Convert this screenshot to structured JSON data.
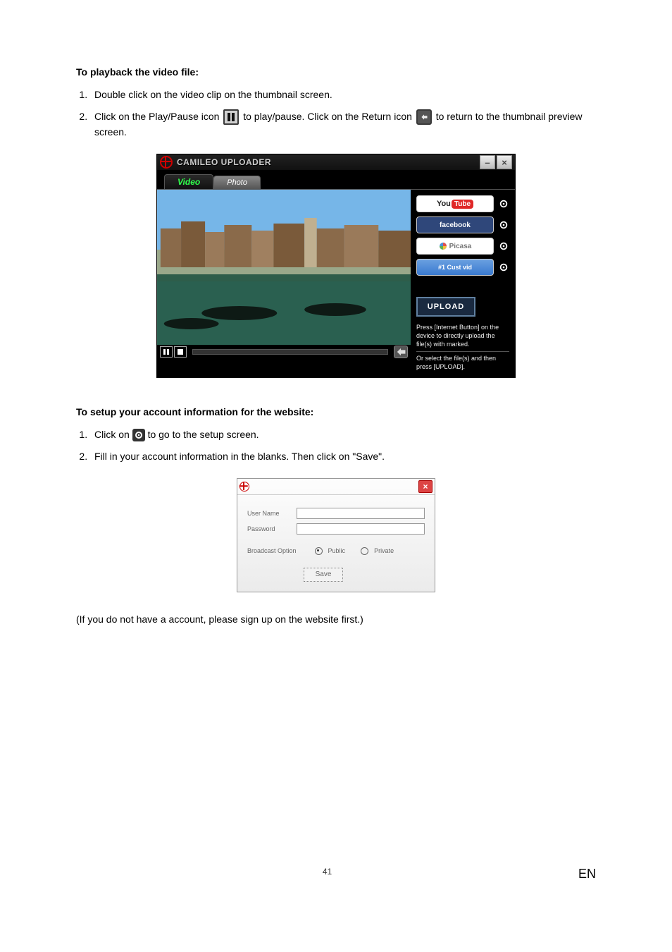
{
  "section1": {
    "heading": "To playback the video file:",
    "step1": "Double click on the video clip on the thumbnail screen.",
    "step2a": "Click on the Play/Pause icon",
    "step2b": "to play/pause. Click on the Return icon",
    "step2c": "to return to the thumbnail preview screen."
  },
  "uploader": {
    "title": "CAMILEO UPLOADER",
    "min": "–",
    "close": "×",
    "tab_video": "Video",
    "tab_photo": "Photo",
    "svc_youtube_you": "You",
    "svc_youtube_tube": "Tube",
    "svc_facebook": "facebook",
    "svc_picasa": "Picasa",
    "svc_custvid": "#1 Cust vid",
    "upload_label": "UPLOAD",
    "note_line1": "Press [Internet Button] on the device to directly upload the file(s) with marked.",
    "note_line2": "Or select the file(s) and then press [UPLOAD]."
  },
  "section2": {
    "heading": "To setup your account information for the website:",
    "step1a": "Click on",
    "step1b": "to go to the setup screen.",
    "step2": "Fill in your account information in the blanks. Then click on \"Save\"."
  },
  "acct": {
    "user_label": "User Name",
    "pass_label": "Password",
    "broadcast_label": "Broadcast Option",
    "opt_public": "Public",
    "opt_private": "Private",
    "save_label": "Save",
    "close": "×"
  },
  "footnote": "(If you do not have a account, please sign up on the website first.)",
  "page_number": "41",
  "lang": "EN"
}
